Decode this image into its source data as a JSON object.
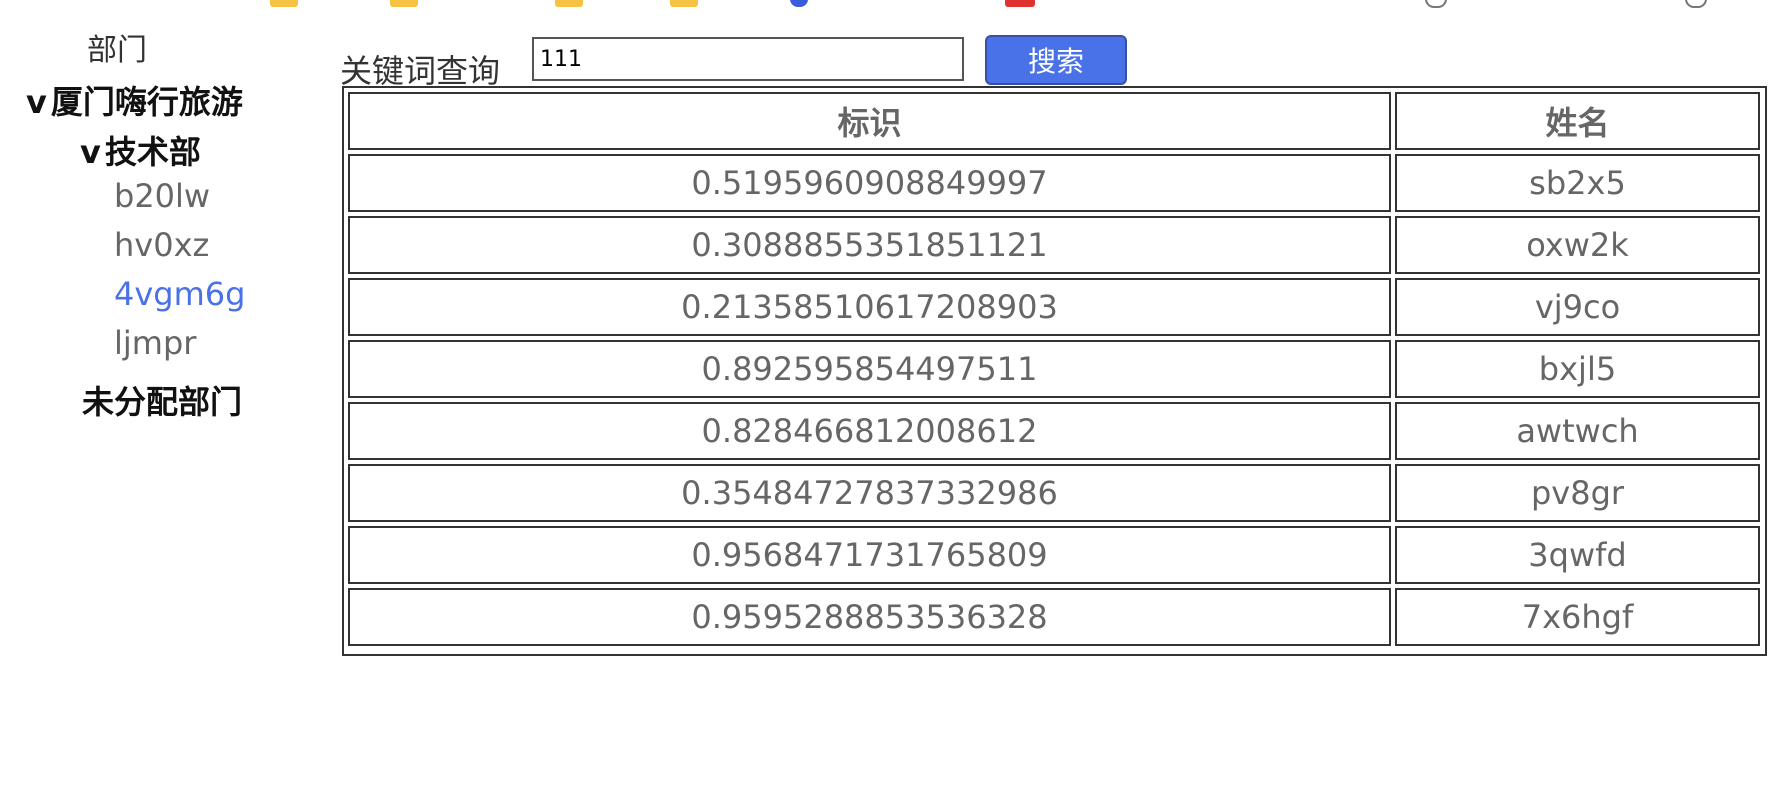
{
  "sidebar": {
    "header": "部门",
    "root": {
      "caret": "v",
      "label": "厦门嗨行旅游"
    },
    "department": {
      "caret": "v",
      "label": "技术部"
    },
    "members": [
      {
        "label": "b20lw",
        "active": false
      },
      {
        "label": "hv0xz",
        "active": false
      },
      {
        "label": "4vgm6g",
        "active": true
      },
      {
        "label": "ljmpr",
        "active": false
      }
    ],
    "unassigned": {
      "label": "未分配部门"
    }
  },
  "search": {
    "label": "关键词查询",
    "value": "111",
    "button_label": "搜索"
  },
  "table": {
    "headers": [
      "标识",
      "姓名"
    ],
    "rows": [
      [
        "0.5195960908849997",
        "sb2x5"
      ],
      [
        "0.3088855351851121",
        "oxw2k"
      ],
      [
        "0.21358510617208903",
        "vj9co"
      ],
      [
        "0.892595854497511",
        "bxjl5"
      ],
      [
        "0.828466812008612",
        "awtwch"
      ],
      [
        "0.35484727837332986",
        "pv8gr"
      ],
      [
        "0.9568471731765809",
        "3qwfd"
      ],
      [
        "0.9595288853536328",
        "7x6hgf"
      ]
    ]
  },
  "colors": {
    "accent": "#4a72e8",
    "text_muted": "#666666"
  }
}
